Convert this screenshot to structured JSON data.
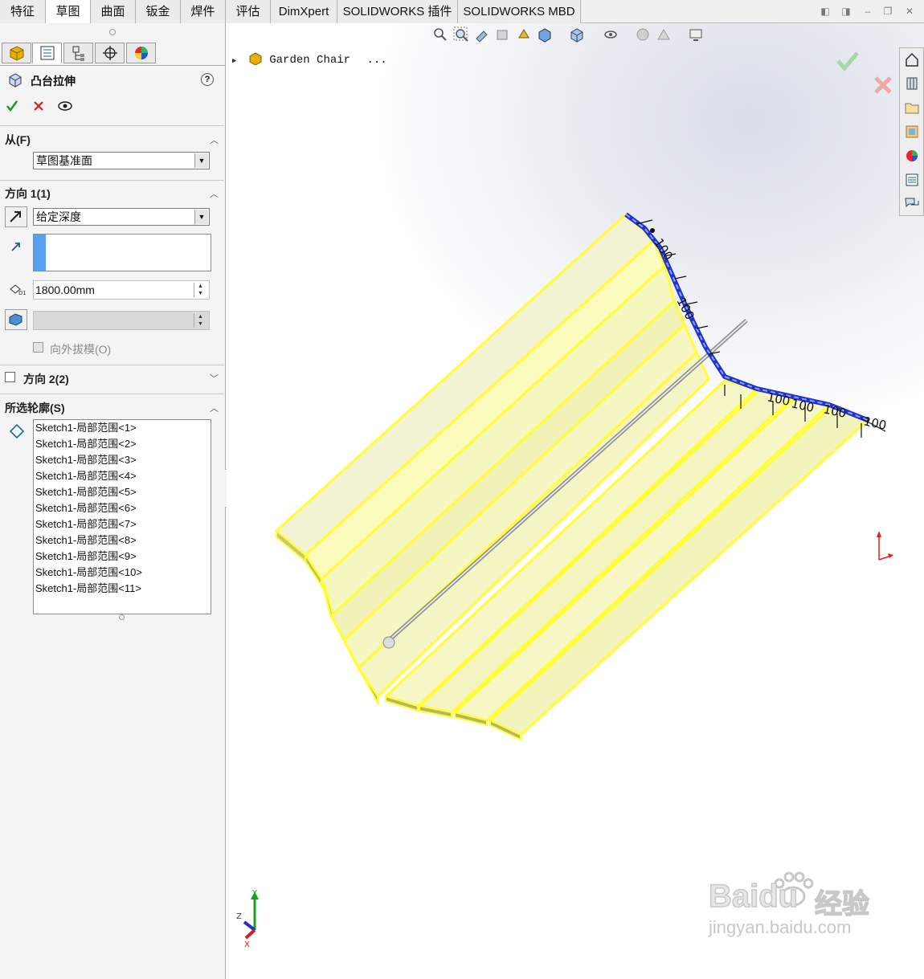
{
  "tabs": [
    "特征",
    "草图",
    "曲面",
    "钣金",
    "焊件",
    "评估",
    "DimXpert",
    "SOLIDWORKS 插件",
    "SOLIDWORKS MBD"
  ],
  "active_tab": "草图",
  "panel": {
    "title": "凸台拉伸",
    "help": "?",
    "from": {
      "header": "从(F)",
      "value": "草图基准面"
    },
    "direction1": {
      "header": "方向 1(1)",
      "end_condition": "给定深度",
      "depth": "1800.00mm",
      "draft_label": "向外拔模(O)"
    },
    "direction2": {
      "header": "方向 2(2)"
    },
    "selected_contours": {
      "header": "所选轮廓(S)",
      "items": [
        "Sketch1-局部范围<1>",
        "Sketch1-局部范围<2>",
        "Sketch1-局部范围<3>",
        "Sketch1-局部范围<4>",
        "Sketch1-局部范围<5>",
        "Sketch1-局部范围<6>",
        "Sketch1-局部范围<7>",
        "Sketch1-局部范围<8>",
        "Sketch1-局部范围<9>",
        "Sketch1-局部范围<10>",
        "Sketch1-局部范围<11>"
      ]
    }
  },
  "viewport": {
    "tree_root": "Garden Chair",
    "tree_ellipsis": "...",
    "triad_labels": [
      "Y",
      "Z",
      "X"
    ],
    "dimension_labels": [
      "100",
      "100",
      "100",
      "100",
      "100",
      "100"
    ]
  },
  "watermark": {
    "brand": "Baidu",
    "suffix": "经验",
    "url": "jingyan.baidu.com"
  },
  "colors": {
    "extrude_yellow": "#ffff33",
    "sketch_blue": "#2233cc",
    "accept_green": "#1a9a1a",
    "cancel_red": "#d42020"
  }
}
